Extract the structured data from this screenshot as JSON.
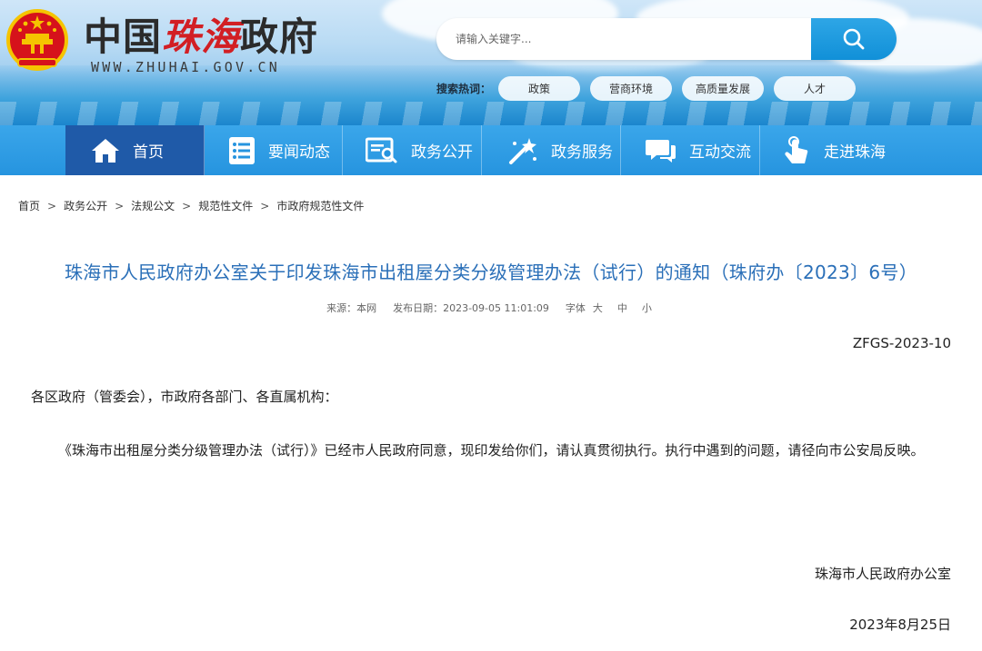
{
  "header": {
    "logo_part1": "中国",
    "logo_part2": "珠海",
    "logo_part3": "政府",
    "url": "WWW.ZHUHAI.GOV.CN",
    "search_placeholder": "请输入关键字...",
    "hot_label": "搜索热词：",
    "hot_words": [
      "政策",
      "营商环境",
      "高质量发展",
      "人才"
    ]
  },
  "nav": {
    "items": [
      {
        "label": "首页",
        "icon": "home-icon"
      },
      {
        "label": "要闻动态",
        "icon": "news-list-icon"
      },
      {
        "label": "政务公开",
        "icon": "document-search-icon"
      },
      {
        "label": "政务服务",
        "icon": "service-wand-icon"
      },
      {
        "label": "互动交流",
        "icon": "chat-bubble-icon"
      },
      {
        "label": "走进珠海",
        "icon": "touch-hand-icon"
      }
    ]
  },
  "breadcrumb": [
    "首页",
    "政务公开",
    "法规公文",
    "规范性文件",
    "市政府规范性文件"
  ],
  "article": {
    "title": "珠海市人民政府办公室关于印发珠海市出租屋分类分级管理办法（试行）的通知（珠府办〔2023〕6号）",
    "source": "来源：本网",
    "publish": "发布日期：2023-09-05 11:01:09",
    "font_label": "字体",
    "font_large": "大",
    "font_medium": "中",
    "font_small": "小",
    "doc_no": "ZFGS-2023-10",
    "salutation": "各区政府（管委会），市政府各部门、各直属机构：",
    "body": "《珠海市出租屋分类分级管理办法（试行）》已经市人民政府同意，现印发给你们，请认真贯彻执行。执行中遇到的问题，请径向市公安局反映。",
    "signature": "珠海市人民政府办公室",
    "date": "2023年8月25日"
  },
  "colors": {
    "nav_bg": "#2694df",
    "nav_active": "#1f5aa8",
    "title": "#2a6fb8",
    "logo_red": "#d21f24"
  }
}
